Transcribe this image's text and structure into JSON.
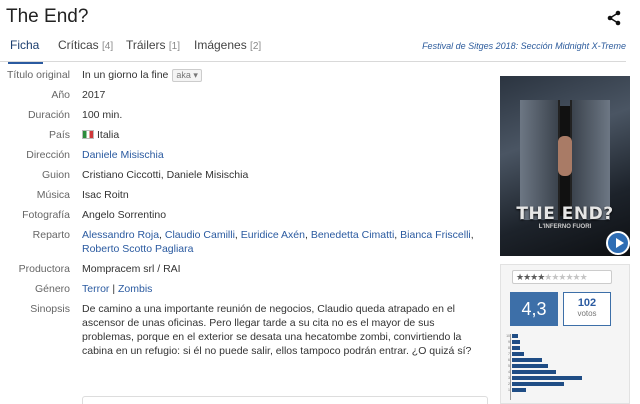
{
  "header": {
    "title": "The End?",
    "share_icon": "share-icon"
  },
  "tabs": [
    {
      "label": "Ficha",
      "count": ""
    },
    {
      "label": "Críticas",
      "count": "[4]"
    },
    {
      "label": "Tráilers",
      "count": "[1]"
    },
    {
      "label": "Imágenes",
      "count": "[2]"
    }
  ],
  "festival": "Festival de Sitges 2018: Sección Midnight X-Treme",
  "details": {
    "original_title": {
      "label": "Título original",
      "value": "In un giorno la fine",
      "aka": "aka"
    },
    "year": {
      "label": "Año",
      "value": "2017"
    },
    "duration": {
      "label": "Duración",
      "value": "100 min."
    },
    "country": {
      "label": "País",
      "value": "Italia",
      "flag": "italy-flag-icon"
    },
    "director": {
      "label": "Dirección",
      "value": "Daniele Misischia"
    },
    "writers": {
      "label": "Guion",
      "value": "Cristiano Ciccotti, Daniele Misischia"
    },
    "music": {
      "label": "Música",
      "value": "Isac Roitn"
    },
    "photography": {
      "label": "Fotografía",
      "value": "Angelo Sorrentino"
    },
    "cast": {
      "label": "Reparto",
      "names": [
        "Alessandro Roja",
        "Claudio Camilli",
        "Euridice Axén",
        "Benedetta Cimatti",
        "Bianca Friscelli",
        "Roberto Scotto Pagliara"
      ]
    },
    "producer": {
      "label": "Productora",
      "value": "Mompracem srl / RAI"
    },
    "genre": {
      "label": "Género",
      "items": [
        "Terror",
        "Zombis"
      ],
      "separator": "|"
    },
    "synopsis": {
      "label": "Sinopsis",
      "value": "De camino a una importante reunión de negocios, Claudio queda atrapado en el ascensor de unas oficinas. Pero llegar tarde a su cita no es el mayor de sus problemas, porque en el exterior se desata una hecatombe zombi, convirtiendo la cabina en un refugio: si él no puede salir, ellos tampoco podrán entrar. ¿O quizá sí?"
    }
  },
  "poster": {
    "title": "THE END?",
    "subtitle": "L'INFERNO FUORI",
    "play_icon": "play-icon"
  },
  "rating": {
    "average": "4,3",
    "votes": "102",
    "votes_label": "votos",
    "stars_filled": 4,
    "stars_total": 10,
    "histogram_ticks": [
      "10",
      "9",
      "8",
      "7",
      "6",
      "5",
      "4",
      "3",
      "2",
      "1"
    ]
  }
}
